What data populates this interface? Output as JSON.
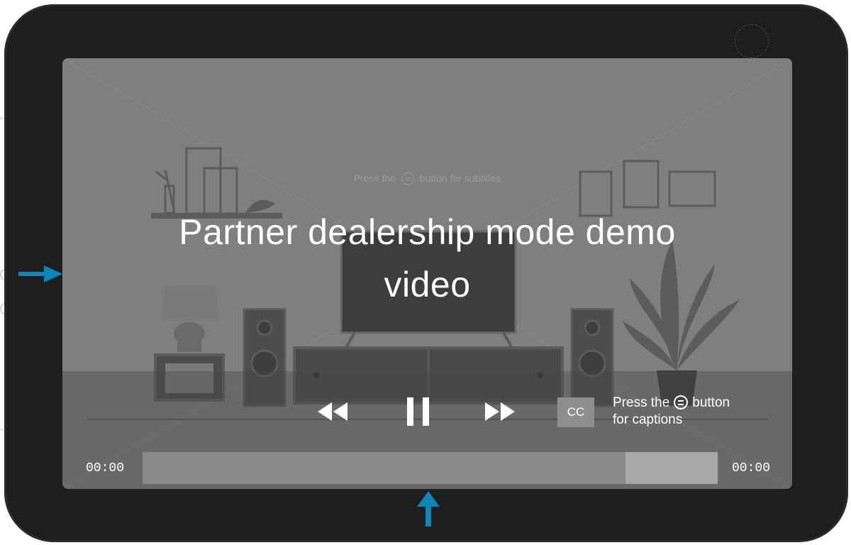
{
  "player": {
    "subtitle_hint_before": "Press the",
    "subtitle_hint_after": "button for subtitles",
    "title": "Partner dealership mode demo video",
    "cc_label": "CC",
    "captions_hint_before": "Press the",
    "captions_hint_after": "button",
    "captions_hint_line2": "for captions",
    "current_time": "00:00",
    "total_time": "00:00",
    "progress_fraction": 0.84,
    "state": "playing"
  },
  "icons": {
    "rewind": "rewind-icon",
    "pause": "pause-icon",
    "forward": "fast-forward-icon",
    "menu": "menu-button-icon"
  },
  "colors": {
    "device": "#1e1e1e",
    "screen_overlay": "#7f7f7f",
    "annotation_arrow": "#0f86b8",
    "progress_fill": "#8a8a8a",
    "progress_track": "#a8a8a8"
  }
}
